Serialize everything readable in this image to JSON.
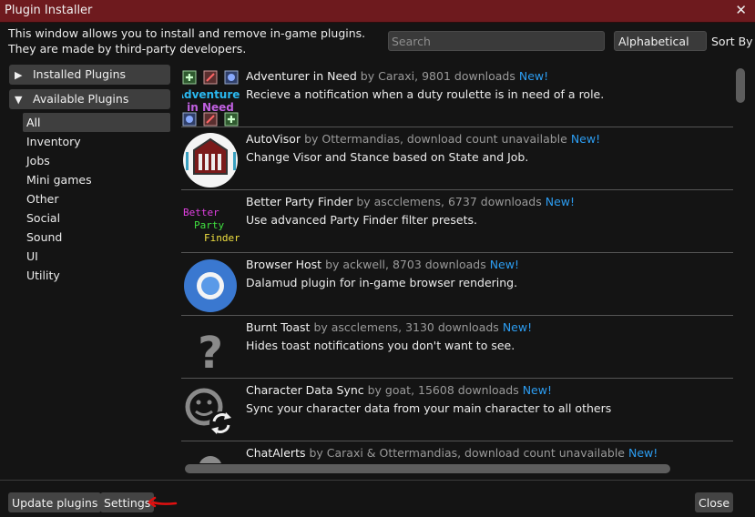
{
  "window": {
    "title": "Plugin Installer"
  },
  "intro": {
    "line1": "This window allows you to install and remove in-game plugins.",
    "line2": "They are made by third-party developers."
  },
  "search": {
    "placeholder": "Search",
    "value": ""
  },
  "sort": {
    "selected": "Alphabetical",
    "label": "Sort By"
  },
  "categories": {
    "installed": "Installed Plugins",
    "available": "Available Plugins",
    "sub": [
      "All",
      "Inventory",
      "Jobs",
      "Mini games",
      "Other",
      "Social",
      "Sound",
      "UI",
      "Utility"
    ]
  },
  "plugins": [
    {
      "name": "Adventurer in Need",
      "byline": "by Caraxi, 9801 downloads",
      "tag": "New!",
      "desc": "Recieve a notification when a duty roulette is in need of a role.",
      "icon_text": [
        "Adventurer",
        "in Need"
      ]
    },
    {
      "name": "AutoVisor",
      "byline": "by Ottermandias, download count unavailable",
      "tag": "New!",
      "desc": "Change Visor and Stance based on State and Job."
    },
    {
      "name": "Better Party Finder",
      "byline": "by ascclemens, 6737 downloads",
      "tag": "New!",
      "desc": "Use advanced Party Finder filter presets.",
      "icon_text": [
        "Better",
        "Party",
        "Finder"
      ]
    },
    {
      "name": "Browser Host",
      "byline": "by ackwell, 8703 downloads",
      "tag": "New!",
      "desc": "Dalamud plugin for in-game browser rendering."
    },
    {
      "name": "Burnt Toast",
      "byline": "by ascclemens, 3130 downloads",
      "tag": "New!",
      "desc": "Hides toast notifications you don't want to see.",
      "icon_text": [
        "?"
      ]
    },
    {
      "name": "Character Data Sync",
      "byline": "by goat, 15608 downloads",
      "tag": "New!",
      "desc": "Sync your character data from your main character to all others"
    },
    {
      "name": "ChatAlerts",
      "byline": "by Caraxi & Ottermandias, download count unavailable",
      "tag": "New!",
      "desc": ""
    }
  ],
  "footer": {
    "update": "Update plugins",
    "settings": "Settings",
    "close": "Close"
  },
  "colors": {
    "titlebar": "#6e1a1e",
    "accent_new": "#2c9cf0",
    "author": "#9a9a9a",
    "annotation": "#e01010"
  }
}
